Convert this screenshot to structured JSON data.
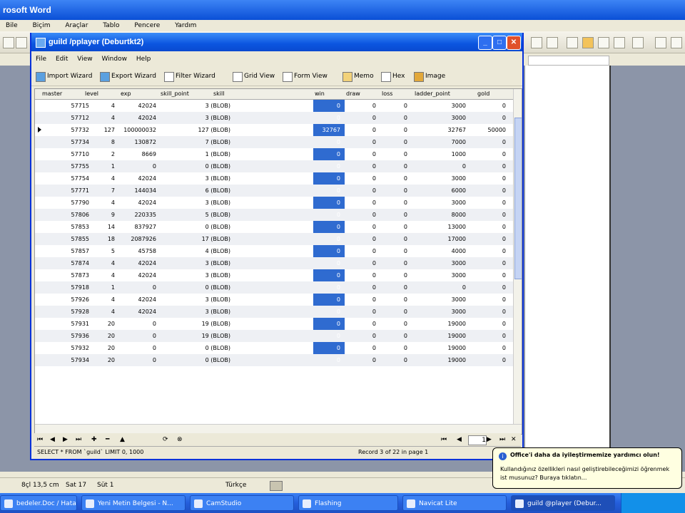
{
  "word": {
    "title": "rosoft Word",
    "menu": [
      "Bile",
      "Biçim",
      "Araçlar",
      "Tablo",
      "Pencere",
      "Yardım"
    ],
    "status": {
      "pos": "8çl  13,5 cm",
      "line": "Sat 17",
      "col": "Süt 1",
      "lang": "Türkçe"
    }
  },
  "navicat": {
    "title": "guild /pplayer (Deburtkt2)",
    "menu": [
      "File",
      "Edit",
      "View",
      "Window",
      "Help"
    ],
    "toolbar": [
      "Import Wizard",
      "Export Wizard",
      "Filter Wizard",
      "Grid View",
      "Form View",
      "Memo",
      "Hex",
      "Image"
    ],
    "columns": [
      "master",
      "level",
      "exp",
      "skill_point",
      "skill",
      "win",
      "draw",
      "loss",
      "ladder_point",
      "gold"
    ],
    "rows": [
      [
        "57715",
        "4",
        "42024",
        "3 (BLOB)",
        "0",
        "0",
        "0",
        "3000",
        "0"
      ],
      [
        "57712",
        "4",
        "42024",
        "3 (BLOB)",
        "0",
        "0",
        "0",
        "3000",
        "0"
      ],
      [
        "57732",
        "127",
        "100000032",
        "127 (BLOB)",
        "32767",
        "0",
        "0",
        "32767",
        "50000"
      ],
      [
        "57734",
        "8",
        "130872",
        "7 (BLOB)",
        "0",
        "0",
        "0",
        "7000",
        "0"
      ],
      [
        "57710",
        "2",
        "8669",
        "1 (BLOB)",
        "0",
        "0",
        "0",
        "1000",
        "0"
      ],
      [
        "57755",
        "1",
        "0",
        "0 (BLOB)",
        "0",
        "0",
        "0",
        "0",
        "0"
      ],
      [
        "57754",
        "4",
        "42024",
        "3 (BLOB)",
        "0",
        "0",
        "0",
        "3000",
        "0"
      ],
      [
        "57771",
        "7",
        "144034",
        "6 (BLOB)",
        "0",
        "0",
        "0",
        "6000",
        "0"
      ],
      [
        "57790",
        "4",
        "42024",
        "3 (BLOB)",
        "0",
        "0",
        "0",
        "3000",
        "0"
      ],
      [
        "57806",
        "9",
        "220335",
        "5 (BLOB)",
        "0",
        "0",
        "0",
        "8000",
        "0"
      ],
      [
        "57853",
        "14",
        "837927",
        "0 (BLOB)",
        "0",
        "0",
        "0",
        "13000",
        "0"
      ],
      [
        "57855",
        "18",
        "2087926",
        "17 (BLOB)",
        "0",
        "0",
        "0",
        "17000",
        "0"
      ],
      [
        "57857",
        "5",
        "45758",
        "4 (BLOB)",
        "0",
        "0",
        "0",
        "4000",
        "0"
      ],
      [
        "57874",
        "4",
        "42024",
        "3 (BLOB)",
        "0",
        "0",
        "0",
        "3000",
        "0"
      ],
      [
        "57873",
        "4",
        "42024",
        "3 (BLOB)",
        "0",
        "0",
        "0",
        "3000",
        "0"
      ],
      [
        "57918",
        "1",
        "0",
        "0 (BLOB)",
        "0",
        "0",
        "0",
        "0",
        "0"
      ],
      [
        "57926",
        "4",
        "42024",
        "3 (BLOB)",
        "0",
        "0",
        "0",
        "3000",
        "0"
      ],
      [
        "57928",
        "4",
        "42024",
        "3 (BLOB)",
        "0",
        "0",
        "0",
        "3000",
        "0"
      ],
      [
        "57931",
        "20",
        "0",
        "19 (BLOB)",
        "0",
        "0",
        "0",
        "19000",
        "0"
      ],
      [
        "57936",
        "20",
        "0",
        "19 (BLOB)",
        "0",
        "0",
        "0",
        "19000",
        "0"
      ],
      [
        "57932",
        "20",
        "0",
        "0 (BLOB)",
        "0",
        "0",
        "0",
        "19000",
        "0"
      ],
      [
        "57934",
        "20",
        "0",
        "0 (BLOB)",
        "0",
        "0",
        "0",
        "19000",
        "0"
      ]
    ],
    "selected_row": 2,
    "page": "1",
    "sql": "SELECT * FROM `guild` LIMIT 0, 1000",
    "record_info": "Record 3 of 22 in page 1",
    "colors": {
      "title": "#0b55e0",
      "selected_column": "#2f6bd0"
    }
  },
  "balloon": {
    "title": "Office'i daha da iyileştirmemize yardımcı olun!",
    "body": "Kullandığınız özellikleri nasıl geliştirebileceğimizi öğrenmek ist musunuz? Buraya tıklatın..."
  },
  "taskbar": {
    "tasks": [
      "bedeler.Doc / Hatay ...",
      "Yeni Metin Belgesi - N...",
      "CamStudio",
      "Flashing",
      "Navicat Lite",
      "guild @player (Debur..."
    ]
  }
}
